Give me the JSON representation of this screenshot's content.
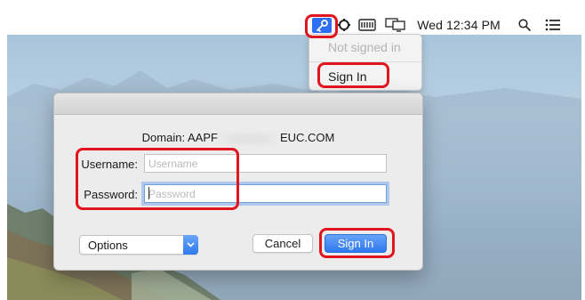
{
  "menubar": {
    "clock": "Wed 12:34 PM",
    "icons": [
      "key-icon",
      "sync-icon",
      "battery-icon",
      "display-icon",
      "search-icon",
      "list-icon"
    ]
  },
  "menu": {
    "status": "Not signed in",
    "sign_in": "Sign In"
  },
  "dialog": {
    "domain_prefix": "Domain: AAPF",
    "domain_suffix": "EUC.COM",
    "username_label": "Username:",
    "username_placeholder": "Username",
    "password_label": "Password:",
    "password_placeholder": "Password",
    "options_label": "Options",
    "cancel_label": "Cancel",
    "sign_in_label": "Sign In"
  },
  "colors": {
    "accent": "#2f78ee",
    "annotation": "#e0151d"
  }
}
